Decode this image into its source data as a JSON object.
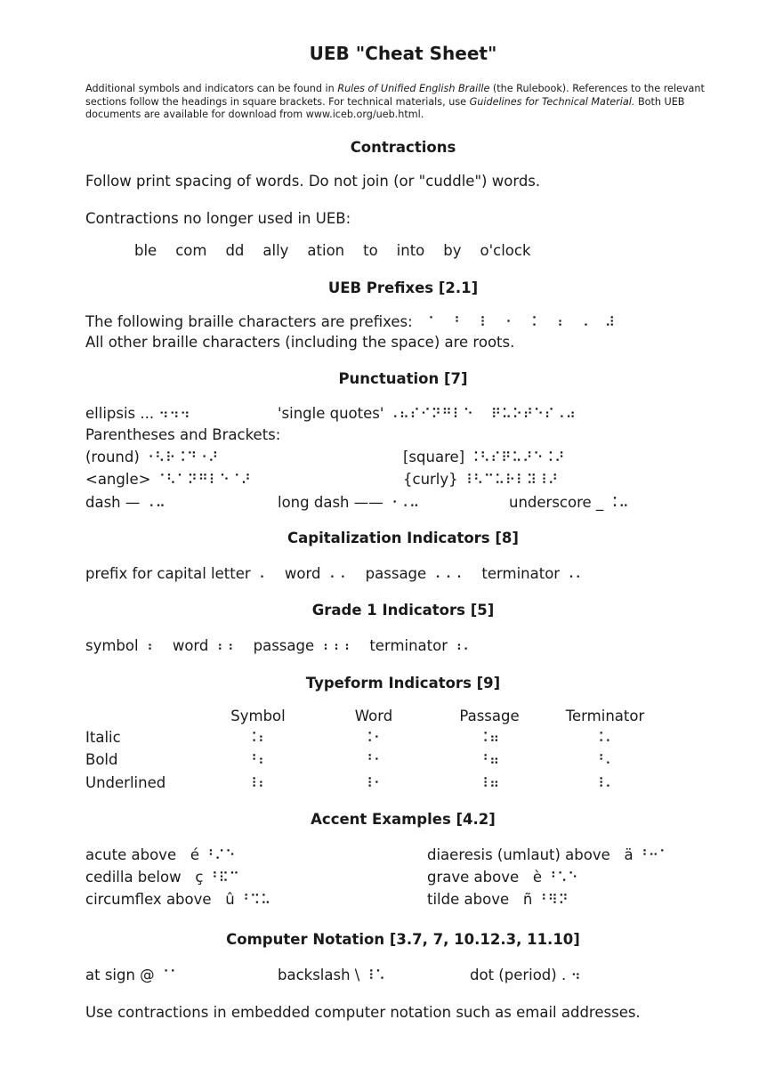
{
  "title": "UEB \"Cheat Sheet\"",
  "intro": {
    "part1": "Additional symbols and indicators can be found in ",
    "rulebook_title": "Rules of Unified English Braille",
    "part2": " (the Rulebook).  References to the relevant sections follow the headings in square brackets.  For technical materials, use ",
    "guidelines_title": "Guidelines for Technical Material.",
    "part3": "  Both UEB documents are available for download from www.iceb.org/ueb.html."
  },
  "contractions": {
    "heading": "Contractions",
    "spacing_note": "Follow print spacing of words.  Do not join (or \"cuddle\") words.",
    "no_longer_label": "Contractions no longer used in UEB:",
    "no_longer_list": [
      "ble",
      "com",
      "dd",
      "ally",
      "ation",
      "to",
      "into",
      "by",
      "o'clock"
    ]
  },
  "prefixes": {
    "heading": "UEB Prefixes [2.1]",
    "line1": "The following braille characters are prefixes:",
    "cells": [
      "⠈",
      "⠘",
      "⠸",
      "⠐",
      "⠨",
      "⠰",
      "⠠",
      "⠼"
    ],
    "line2": "All other braille characters (including the space) are roots."
  },
  "punctuation": {
    "heading": "Punctuation [7]",
    "ellipsis_label": "ellipsis ...",
    "ellipsis_braille": "⠲⠲⠲",
    "single_quotes_label": "'single quotes'",
    "single_quotes_braille_1": "⠠⠦⠎⠊⠝⠛⠇⠑",
    "single_quotes_braille_2": "⠟⠥⠕⠞⠑⠎⠠⠴",
    "parens_label": "Parentheses and Brackets:",
    "round_label": "(round)",
    "round_braille": "⠐⠣⠗⠨⠙⠐⠜",
    "square_label": "[square]",
    "square_braille": "⠨⠣⠎⠟⠥⠜⠑⠨⠜",
    "angle_label": "<angle>",
    "angle_braille": "⠈⠣⠁⠝⠛⠇⠑⠈⠜",
    "curly_label": "{curly}",
    "curly_braille": "⠸⠣⠉⠥⠗⠇⠽⠸⠜",
    "dash_label": "dash —",
    "dash_braille": "⠠⠤",
    "long_dash_label": "long dash ——",
    "long_dash_braille": "⠐⠠⠤",
    "underscore_label": "underscore _",
    "underscore_braille": "⠨⠤"
  },
  "capitalization": {
    "heading": "Capitalization Indicators [8]",
    "items": [
      {
        "label": "prefix for capital letter",
        "braille": "⠠"
      },
      {
        "label": "word",
        "braille": "⠠⠠"
      },
      {
        "label": "passage",
        "braille": "⠠⠠⠠"
      },
      {
        "label": "terminator",
        "braille": "⠠⠄"
      }
    ]
  },
  "grade1": {
    "heading": "Grade 1 Indicators [5]",
    "items": [
      {
        "label": "symbol",
        "braille": "⠰"
      },
      {
        "label": "word",
        "braille": "⠰⠰"
      },
      {
        "label": "passage",
        "braille": "⠰⠰⠰"
      },
      {
        "label": "terminator",
        "braille": "⠰⠄"
      }
    ]
  },
  "typeform": {
    "heading": "Typeform Indicators [9]",
    "columns": [
      "Symbol",
      "Word",
      "Passage",
      "Terminator"
    ],
    "rows": [
      {
        "label": "Italic",
        "cells": [
          "⠨⠆",
          "⠨⠂",
          "⠨⠶",
          "⠨⠄"
        ]
      },
      {
        "label": "Bold",
        "cells": [
          "⠘⠆",
          "⠘⠂",
          "⠘⠶",
          "⠘⠄"
        ]
      },
      {
        "label": "Underlined",
        "cells": [
          "⠸⠆",
          "⠸⠂",
          "⠸⠶",
          "⠸⠄"
        ]
      }
    ]
  },
  "accents": {
    "heading": "Accent Examples [4.2]",
    "left": [
      {
        "label": "acute above",
        "char": "é",
        "braille": "⠘⠌⠑"
      },
      {
        "label": "cedilla below",
        "char": "ç",
        "braille": "⠘⠯⠉"
      },
      {
        "label": "circumflex above",
        "char": "û",
        "braille": "⠘⠩⠥"
      }
    ],
    "right": [
      {
        "label": "diaeresis (umlaut) above",
        "char": "ä",
        "braille": "⠘⠒⠁"
      },
      {
        "label": "grave above",
        "char": "è",
        "braille": "⠘⠡⠑"
      },
      {
        "label": "tilde above",
        "char": "ñ",
        "braille": "⠘⠻⠝"
      }
    ]
  },
  "computer": {
    "heading": "Computer Notation [3.7, 7, 10.12.3, 11.10]",
    "items": [
      {
        "label": "at sign @",
        "braille": "⠈⠁"
      },
      {
        "label": "backslash \\",
        "braille": "⠸⠡"
      },
      {
        "label": "dot (period) .",
        "braille": "⠲"
      }
    ],
    "note": "Use contractions in embedded computer notation such as email addresses."
  }
}
